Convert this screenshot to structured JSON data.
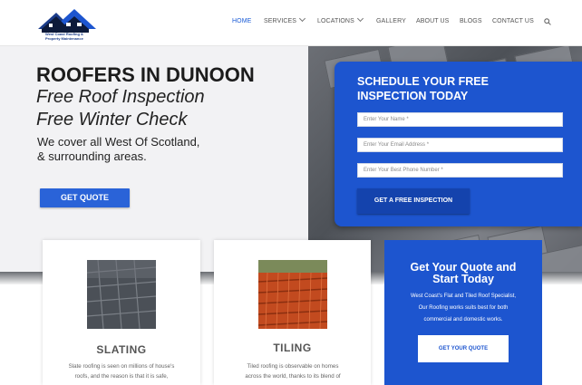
{
  "header": {
    "logo_line1": "West Coast Roofing &",
    "logo_line2": "Property Maintenance",
    "nav": [
      {
        "label": "HOME"
      },
      {
        "label": "SERVICES"
      },
      {
        "label": "LOCATIONS"
      },
      {
        "label": "GALLERY"
      },
      {
        "label": "ABOUT US"
      },
      {
        "label": "BLOGS"
      },
      {
        "label": "CONTACT US"
      }
    ],
    "active_nav": "HOME"
  },
  "hero": {
    "title": "ROOFERS IN DUNOON",
    "sub1": "Free Roof Inspection",
    "sub2": "Free Winter Check",
    "line1": "We cover all West Of Scotland,",
    "line2": "& surrounding areas.",
    "button": "GET QUOTE"
  },
  "form": {
    "title1": "SCHEDULE YOUR FREE",
    "title2": "INSPECTION TODAY",
    "name_placeholder": "Enter Your Name *",
    "email_placeholder": "Enter Your Email Address *",
    "phone_placeholder": "Enter Your Best Phone Number *",
    "button": "GET A FREE INSPECTION"
  },
  "cards": [
    {
      "title": "SLATING",
      "line1": "Slate roofing is seen on millions of house's",
      "line2": "roofs, and the reason is that it is safe,"
    },
    {
      "title": "TILING",
      "line1": "Tiled roofing is observable on homes",
      "line2": "across the world, thanks to its blend of"
    }
  ],
  "cta": {
    "title1": "Get Your Quote and",
    "title2": "Start Today",
    "line1": "West Coast's Flat and Tiled Roof Specialist,",
    "line2": "Our Roofing works suits best for both",
    "line3": "commercial and domestic works.",
    "button": "GET YOUR QUOTE"
  },
  "colors": {
    "accent": "#1d55cf",
    "button": "#2a63d8",
    "nav_active": "#1a5bd6"
  },
  "icons": [
    "house-logo-icon",
    "chevron-down-icon",
    "search-icon"
  ]
}
